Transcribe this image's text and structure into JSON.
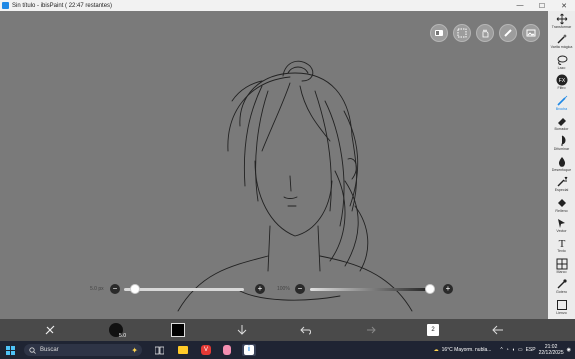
{
  "window": {
    "title": "Sin título - ibisPaint ( 22:47 restantes)",
    "controls": [
      "—",
      "☐",
      "✕"
    ]
  },
  "canvas_buttons": [
    "layers-toggle-icon",
    "selection-icon",
    "hand-icon",
    "ruler-icon",
    "gallery-icon"
  ],
  "tools": [
    {
      "label": "Transformar",
      "icon": "move-icon"
    },
    {
      "label": "Varita mágica",
      "icon": "magic-wand-icon"
    },
    {
      "label": "Lazo",
      "icon": "lasso-icon"
    },
    {
      "label": "Filtro",
      "icon": "fx-icon",
      "glyph": "FX"
    },
    {
      "label": "Brocha",
      "icon": "brush-icon",
      "active": true
    },
    {
      "label": "Borrador",
      "icon": "eraser-icon"
    },
    {
      "label": "Difuminar",
      "icon": "smudge-icon"
    },
    {
      "label": "Desenfoque",
      "icon": "blur-icon"
    },
    {
      "label": "Especial",
      "icon": "special-icon"
    },
    {
      "label": "Relleno",
      "icon": "fill-icon"
    },
    {
      "label": "Vector",
      "icon": "vector-icon"
    },
    {
      "label": "Texto",
      "icon": "text-icon",
      "glyph": "T"
    },
    {
      "label": "Marco",
      "icon": "frame-icon"
    },
    {
      "label": "Gotero",
      "icon": "eyedropper-icon"
    },
    {
      "label": "Lienzo",
      "icon": "canvas-icon"
    }
  ],
  "sliders": {
    "size_label": "5.0 px",
    "opacity_label": "100%",
    "size_fraction": 0.05,
    "opacity_fraction": 1.0
  },
  "bottom_bar": {
    "brush_size": "5.0",
    "layer_count": "2"
  },
  "taskbar": {
    "search_placeholder": "Buscar",
    "weather": "16°C  Mayorm. nubla...",
    "language": "ESP",
    "time": "21:02",
    "date": "22/12/2025"
  }
}
